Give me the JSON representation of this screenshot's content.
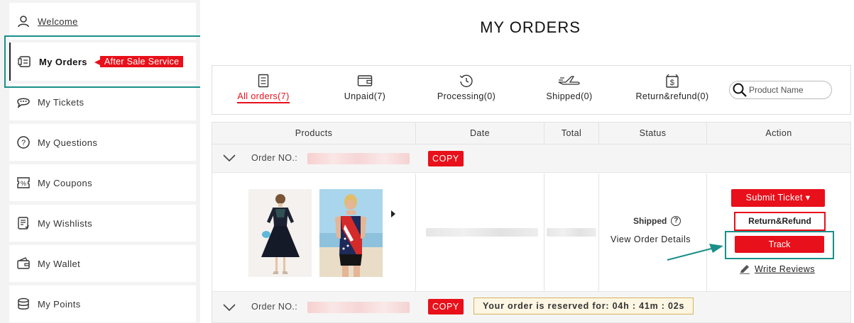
{
  "sidebar": {
    "items": [
      {
        "label": "Welcome",
        "icon": "user-icon"
      },
      {
        "label": "My Orders",
        "icon": "orders-icon"
      },
      {
        "label": "My Tickets",
        "icon": "chat-icon"
      },
      {
        "label": "My Questions",
        "icon": "question-icon"
      },
      {
        "label": "My Coupons",
        "icon": "coupon-icon"
      },
      {
        "label": "My Wishlists",
        "icon": "wishlist-icon"
      },
      {
        "label": "My Wallet",
        "icon": "wallet-icon"
      },
      {
        "label": "My Points",
        "icon": "points-icon"
      }
    ],
    "after_sale_label": "After Sale Service"
  },
  "main": {
    "title": "MY ORDERS",
    "tabs": [
      {
        "label": "All orders(7)",
        "icon": "document-icon",
        "active": true
      },
      {
        "label": "Unpaid(7)",
        "icon": "wallet-icon"
      },
      {
        "label": "Processing(0)",
        "icon": "history-icon"
      },
      {
        "label": "Shipped(0)",
        "icon": "plane-icon"
      },
      {
        "label": "Return&refund(0)",
        "icon": "refund-icon"
      }
    ],
    "search": {
      "placeholder": "Product Name"
    },
    "table": {
      "headers": [
        "Products",
        "Date",
        "Total",
        "Status",
        "Action"
      ],
      "orders": [
        {
          "order_no_label": "Order NO.:",
          "copy_label": "COPY",
          "status": "Shipped",
          "view_details": "View Order Details",
          "actions": {
            "submit_ticket": "Submit Ticket ▾",
            "return_refund": "Return&Refund",
            "track": "Track",
            "write_reviews": "Write Reviews"
          }
        },
        {
          "order_no_label": "Order NO.:",
          "copy_label": "COPY",
          "reserved_text": "Your order is reserved for:  04h :  41m :  02s"
        }
      ]
    }
  },
  "colors": {
    "accent": "#e8101a",
    "highlight": "#1a8f8a"
  }
}
